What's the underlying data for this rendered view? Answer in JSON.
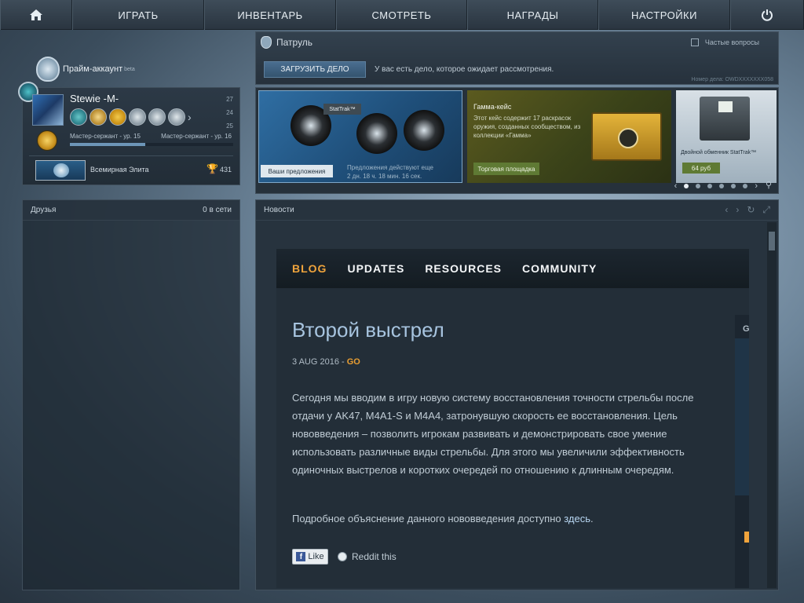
{
  "nav": {
    "play": "ИГРАТЬ",
    "inventory": "ИНВЕНТАРЬ",
    "watch": "СМОТРЕТЬ",
    "rewards": "НАГРАДЫ",
    "settings": "НАСТРОЙКИ"
  },
  "prime": {
    "label": "Прайм-аккаунт",
    "sub": "beta"
  },
  "profile": {
    "name": "Stewie -M-",
    "stats": [
      "27",
      "24",
      "25"
    ],
    "rank_current": "Мастер-сержант - ур. 15",
    "rank_next": "Мастер-сержант - ур. 16",
    "xp_progress": 0.46,
    "skill_group": "Всемирная Элита",
    "trophies": "431"
  },
  "friends": {
    "title": "Друзья",
    "online": "0 в сети"
  },
  "patrol": {
    "title": "Патруль",
    "faq": "Частые вопросы",
    "upload_button": "ЗАГРУЗИТЬ ДЕЛО",
    "message": "У вас есть дело, которое ожидает рассмотрения.",
    "case_number": "Номер дела: OWDXXXXXXX058"
  },
  "store": {
    "offer1": {
      "stattrak": "StatTrak™",
      "tag": "Ваши предложения",
      "valid_line1": "Предложения действуют еще",
      "valid_line2": "2 дн. 18 ч. 18 мин. 16 сек."
    },
    "offer2": {
      "title": "Гамма-кейс",
      "text": "Этот кейс содержит 17 раскрасок оружия, созданных сообществом, из коллекции «Гамма»",
      "button": "Торговая площадка"
    },
    "offer3": {
      "title": "Двойной обменник StatTrak™",
      "price": "64 руб"
    }
  },
  "news": {
    "title": "Новости",
    "tabs": [
      "BLOG",
      "UPDATES",
      "RESOURCES",
      "COMMUNITY"
    ],
    "article_title": "Второй выстрел",
    "date": "3 AUG 2016 - ",
    "date_tag": "GO",
    "body": "Сегодня мы вводим в игру новую систему восстановления точности стрельбы после отдачи у AK47, M4A1-S и M4A4, затронувшую скорость ее восстановления. Цель нововведения – позволить игрокам развивать и демонстрировать свое умение использовать различные виды стрельбы. Для этого мы увеличили эффективность одиночных выстрелов и коротких очередей по отношению к длинным очередям.",
    "more_text": "Подробное объяснение данного нововведения доступно ",
    "more_link": "здесь",
    "more_end": ".",
    "like": "Like",
    "reddit": "Reddit this",
    "side_letter": "G"
  }
}
